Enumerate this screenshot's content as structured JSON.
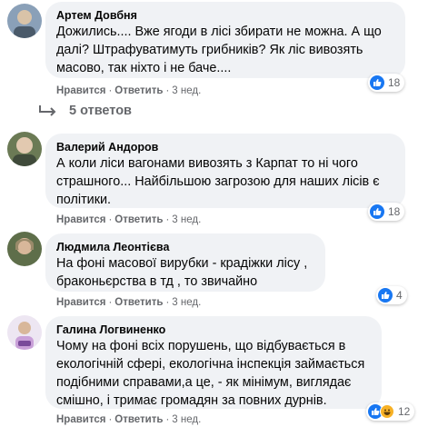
{
  "comments": [
    {
      "author": "Артем Довбня",
      "text": "Дожились.... Вже ягоди в лісі збирати не можна. А що\nдалі? Штрафуватимуть грибників? Як ліс вивозять\nмасово, так ніхто і не баче....",
      "like_label": "Нравится",
      "reply_label": "Ответить",
      "time": "3 нед.",
      "reactions": "18",
      "avatar_colors": [
        "#8aa0b8",
        "#d9c3a8",
        "#4a5a6a"
      ]
    },
    {
      "author": "Валерий Андоров",
      "text": "А коли ліси вагонами вивозять з Карпат то ні чого\nстрашного... Найбільшою загрозою для наших лісів є\nполітики.",
      "like_label": "Нравится",
      "reply_label": "Ответить",
      "time": "3 нед.",
      "reactions": "18",
      "avatar_colors": [
        "#6b7a55",
        "#e2c9b0",
        "#3f4a3a"
      ]
    },
    {
      "author": "Людмила Леонтієва",
      "text": "На фоні масової вирубки - крадіжки лісу ,\nбраконьєрства в тд , то звичайно",
      "like_label": "Нравится",
      "reply_label": "Ответить",
      "time": "3 нед.",
      "reactions": "4",
      "avatar_colors": [
        "#5e6e4a",
        "#d8b79a",
        "#9a8a6a"
      ]
    },
    {
      "author": "Галина Логвиненко",
      "text": "Чому на фоні всіх порушень, що відбувається в\nекологічній сфері, екологічна інспекція займається\nподібними справами,а це, - як мінімум, виглядає\nсмішно, і тримає громадян за повних дурнів.",
      "like_label": "Нравится",
      "reply_label": "Ответить",
      "time": "3 нед.",
      "reactions": "12",
      "avatar_colors": [
        "#e8e0f0",
        "#c9a0d8",
        "#7a4a9a"
      ]
    }
  ],
  "replies_label": "5 ответов",
  "colors": {
    "bubble": "#f0f2f5",
    "like_blue": "#1877f2",
    "meta_gray": "#65676b",
    "haha_yellow": "#f7b125"
  }
}
